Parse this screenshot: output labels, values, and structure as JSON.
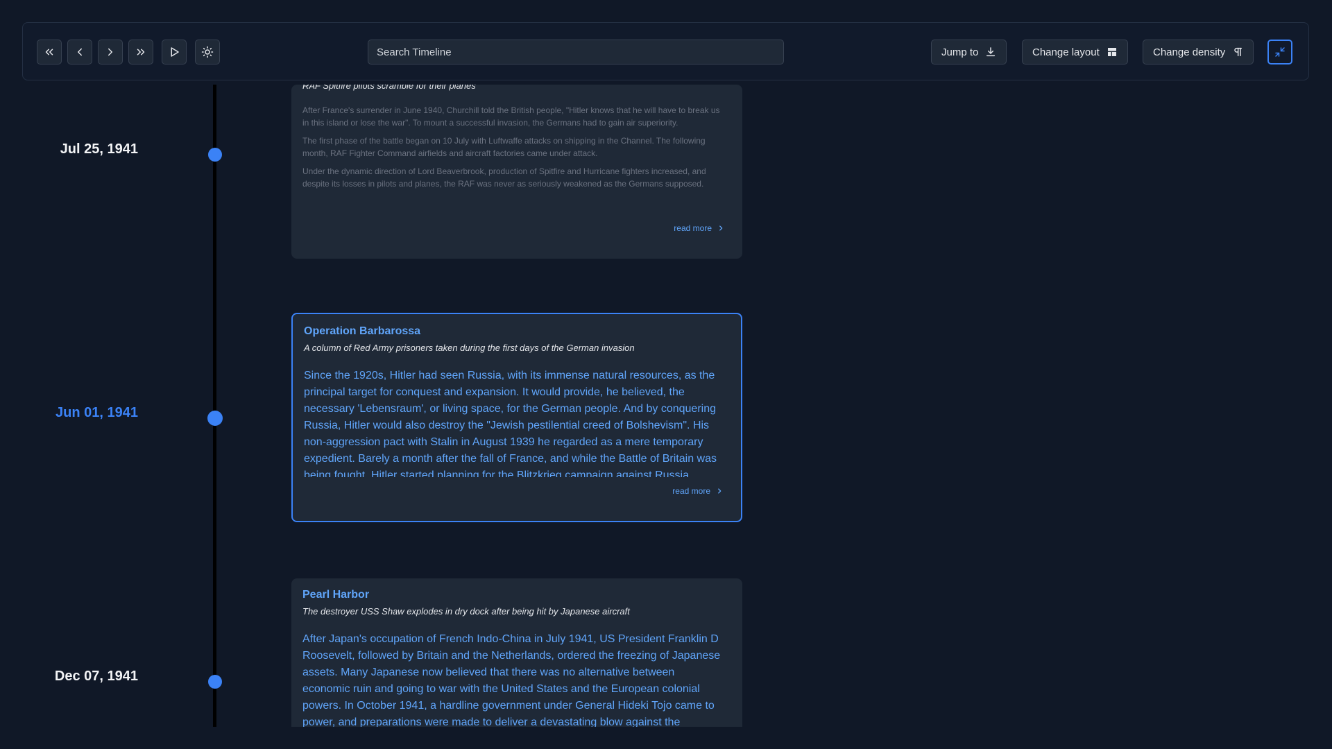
{
  "toolbar": {
    "buttons": [
      {
        "name": "first",
        "icon": "chevrons-left-icon"
      },
      {
        "name": "previous",
        "icon": "chevron-left-icon"
      },
      {
        "name": "next",
        "icon": "chevron-right-icon"
      },
      {
        "name": "last",
        "icon": "chevrons-right-icon"
      },
      {
        "name": "play",
        "icon": "play-icon"
      },
      {
        "name": "theme",
        "icon": "sun-icon"
      }
    ],
    "search_placeholder": "Search Timeline",
    "jump_to_label": "Jump to",
    "change_layout_label": "Change layout",
    "change_density_label": "Change density",
    "collapse_icon": "minimize-icon"
  },
  "colors": {
    "background": "#101827",
    "card": "#1f2937",
    "accent": "#3b82f6",
    "title": "#60a5fa",
    "timeline_line": "#000000"
  },
  "timeline": {
    "items": [
      {
        "date": "Jul 25, 1941",
        "title": "",
        "subtitle": "RAF Spitfire pilots scramble for their planes",
        "paragraphs": [
          "After France's surrender in June 1940, Churchill told the British people, \"Hitler knows that he will have to break us in this island or lose the war\". To mount a successful invasion, the Germans had to gain air superiority.",
          "The first phase of the battle began on 10 July with Luftwaffe attacks on shipping in the Channel. The following month, RAF Fighter Command airfields and aircraft factories came under attack.",
          "Under the dynamic direction of Lord Beaverbrook, production of Spitfire and Hurricane fighters increased, and despite its losses in pilots and planes, the RAF was never as seriously weakened as the Germans supposed."
        ],
        "read_more": "read more",
        "active": false
      },
      {
        "date": "Jun 01, 1941",
        "title": "Operation Barbarossa",
        "subtitle": "A column of Red Army prisoners taken during the first days of the German invasion",
        "paragraphs": [
          "Since the 1920s, Hitler had seen Russia, with its immense natural resources, as the principal target for conquest and expansion. It would provide, he believed, the necessary 'Lebensraum', or living space, for the German people. And by conquering Russia, Hitler would also destroy the \"Jewish pestilential creed of Bolshevism\". His non-aggression pact with Stalin in August 1939 he regarded as a mere temporary expedient. Barely a month after the fall of France, and while the Battle of Britain was being fought, Hitler started planning for the Blitzkrieg campaign against Russia."
        ],
        "read_more": "read more",
        "active": true
      },
      {
        "date": "Dec 07, 1941",
        "title": "Pearl Harbor",
        "subtitle": "The destroyer USS Shaw explodes in dry dock after being hit by Japanese aircraft",
        "paragraphs": [
          "After Japan's occupation of French Indo-China in July 1941, US President Franklin D Roosevelt, followed by Britain and the Netherlands, ordered the freezing of Japanese assets. Many Japanese now believed that there was no alternative between economic ruin and going to war with the United States and the European colonial powers. In October 1941, a hardline government under General Hideki Tojo came to power, and preparations were made to deliver a devastating blow against the Americans."
        ],
        "read_more": "read more",
        "active": false
      }
    ]
  }
}
